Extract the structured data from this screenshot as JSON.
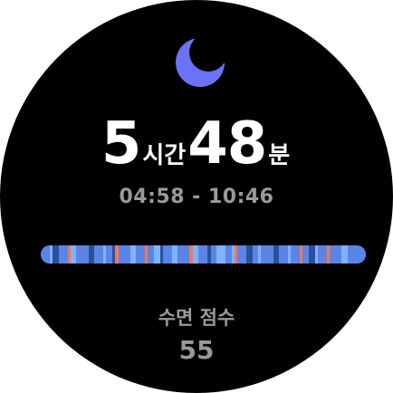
{
  "icon": "moon-icon",
  "colors": {
    "moon": "#6b72f5",
    "awake": "#f07a55",
    "rem": "#7fb2ff",
    "light": "#5a85e6",
    "deep": "#2b4f9a"
  },
  "duration": {
    "hours": "5",
    "hours_unit": "시간",
    "minutes": "48",
    "minutes_unit": "분"
  },
  "time_range": "04:58 - 10:46",
  "hypnogram": {
    "stages": [
      "light",
      "rem",
      "deep",
      "light",
      "awake",
      "rem",
      "light",
      "deep",
      "light",
      "rem",
      "light",
      "deep",
      "awake",
      "light",
      "rem",
      "light",
      "awake",
      "light",
      "rem",
      "deep",
      "light",
      "rem",
      "light",
      "awake",
      "rem",
      "light",
      "deep",
      "light",
      "rem",
      "light",
      "rem",
      "awake",
      "light",
      "deep",
      "light",
      "rem",
      "light",
      "deep",
      "light",
      "rem",
      "light",
      "awake",
      "light",
      "deep",
      "rem",
      "light",
      "awake",
      "light",
      "rem",
      "light"
    ]
  },
  "score": {
    "label": "수면 점수",
    "value": "55"
  }
}
